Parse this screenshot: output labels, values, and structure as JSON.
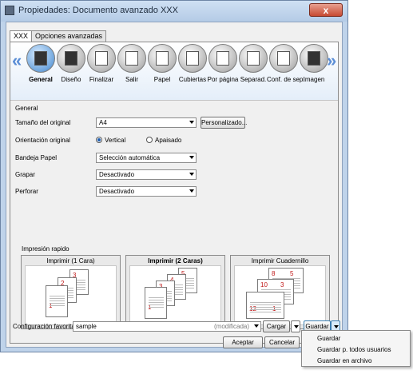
{
  "window": {
    "title": "Propiedades: Documento avanzado XXX",
    "close_glyph": "x"
  },
  "tabs": [
    {
      "label": "XXX"
    },
    {
      "label": "Opciones avanzadas"
    }
  ],
  "iconbar": {
    "left_arrow": "«",
    "right_arrow": "»",
    "items": [
      {
        "label": "General",
        "icon": "general-icon"
      },
      {
        "label": "Diseño",
        "icon": "layout-icon"
      },
      {
        "label": "Finalizar",
        "icon": "finishing-icon"
      },
      {
        "label": "Salir",
        "icon": "output-icon"
      },
      {
        "label": "Papel",
        "icon": "paper-icon"
      },
      {
        "label": "Cubiertas",
        "icon": "covers-icon"
      },
      {
        "label": "Por página",
        "icon": "per-page-icon"
      },
      {
        "label": "Separad.",
        "icon": "separator-icon"
      },
      {
        "label": "Conf. de sep.",
        "icon": "separator-settings-icon"
      },
      {
        "label": "Imagen",
        "icon": "image-icon"
      }
    ]
  },
  "general": {
    "section_title": "General",
    "original_size_label": "Tamaño del original",
    "original_size_value": "A4",
    "custom_button": "Personalizado...",
    "orientation_label": "Orientación original",
    "orientation_vertical": "Vertical",
    "orientation_landscape": "Apaisado",
    "tray_label": "Bandeja Papel",
    "tray_value": "Selección automática",
    "staple_label": "Grapar",
    "staple_value": "Desactivado",
    "punch_label": "Perforar",
    "punch_value": "Desactivado"
  },
  "quick_print": {
    "title": "Impresión rapido",
    "options": [
      {
        "label": "Imprimir (1 Cara)",
        "size": "A4",
        "pages": [
          "1",
          "2",
          "3"
        ]
      },
      {
        "label": "Imprimir (2 Caras)",
        "size": "A4",
        "pages": [
          "1",
          "2",
          "3",
          "4",
          "5",
          "6"
        ]
      },
      {
        "label": "Imprimir Cuadernillo",
        "size": "A3",
        "pages": [
          "12",
          "1",
          "10",
          "3",
          "8",
          "5"
        ]
      }
    ]
  },
  "favorites": {
    "label": "Configuración favorita",
    "value": "sample",
    "status": "(modificada)",
    "load_button": "Cargar",
    "save_button": "Guardar"
  },
  "dialog_buttons": {
    "ok": "Aceptar",
    "cancel": "Cancelar"
  },
  "save_menu": {
    "items": [
      "Guardar",
      "Guardar p. todos usuarios",
      "Guardar en archivo"
    ]
  }
}
